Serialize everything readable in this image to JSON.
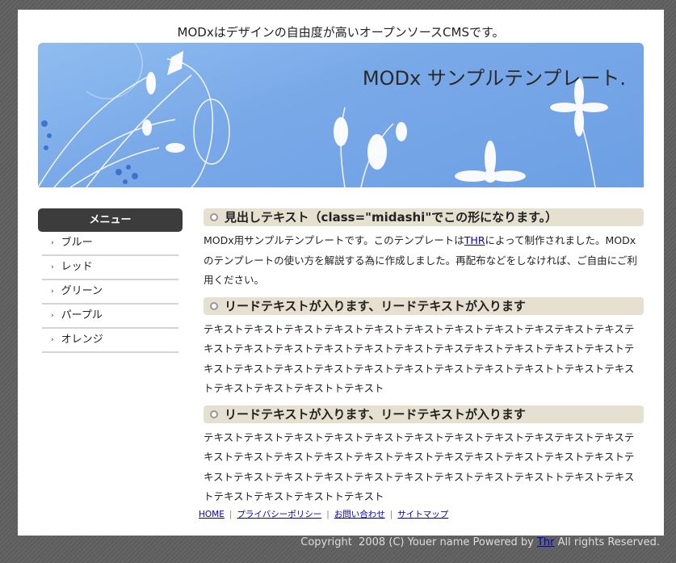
{
  "header": {
    "tagline": "MODxはデザインの自由度が高いオープンソースCMSです。",
    "banner_title": "MODx サンプルテンプレート."
  },
  "sidebar": {
    "title": "メニュー",
    "items": [
      {
        "label": "ブルー"
      },
      {
        "label": "レッド"
      },
      {
        "label": "グリーン"
      },
      {
        "label": "パープル"
      },
      {
        "label": "オレンジ"
      }
    ]
  },
  "main": {
    "heading1": "見出しテキスト（class=\"midashi\"でこの形になります。）",
    "intro_before": "MODx用サンプルテンプレートです。このテンプレートは",
    "intro_link": "THR",
    "intro_after": "によって制作されました。MODxのテンプレートの使い方を解説する為に作成しました。再配布などをしなければ、ご自由にご利用ください。",
    "heading2": "リードテキストが入ります、リードテキストが入ります",
    "body2": "テキストテキストテキストテキストテキストテキストテキストテキストテキステキストテキステキストテキストテキストテキストテキストテキストテキステキストテキストテキストテキストテキストテキストテキストテキストテキストテキストテキストテキストテキストトテキストテキストテキストテキストテキストトテキスト",
    "heading3": "リードテキストが入ります、リードテキストが入ります",
    "body3": "テキストテキストテキストテキストテキストテキストテキストテキストテキステキストテキステキストテキストテキストテキストテキストテキストテキステキストテキストテキストテキストテキストテキストテキストテキストテキストテキストテキストテキストテキストトテキストテキストテキストテキストテキストトテキスト"
  },
  "footer": {
    "links": [
      "HOME",
      "プライバシーポリシー",
      "お問い合わせ",
      "サイトマップ"
    ],
    "sep": "|",
    "copy_before": "Copyright  2008 (C) Youer name Powered by ",
    "copy_link": "Thr",
    "copy_after": " All rights Reserved."
  },
  "colors": {
    "banner": "#7aa9e8",
    "menu_head": "#3c3c3c",
    "heading_bg": "#e6e0d0",
    "link": "#0000cc"
  }
}
